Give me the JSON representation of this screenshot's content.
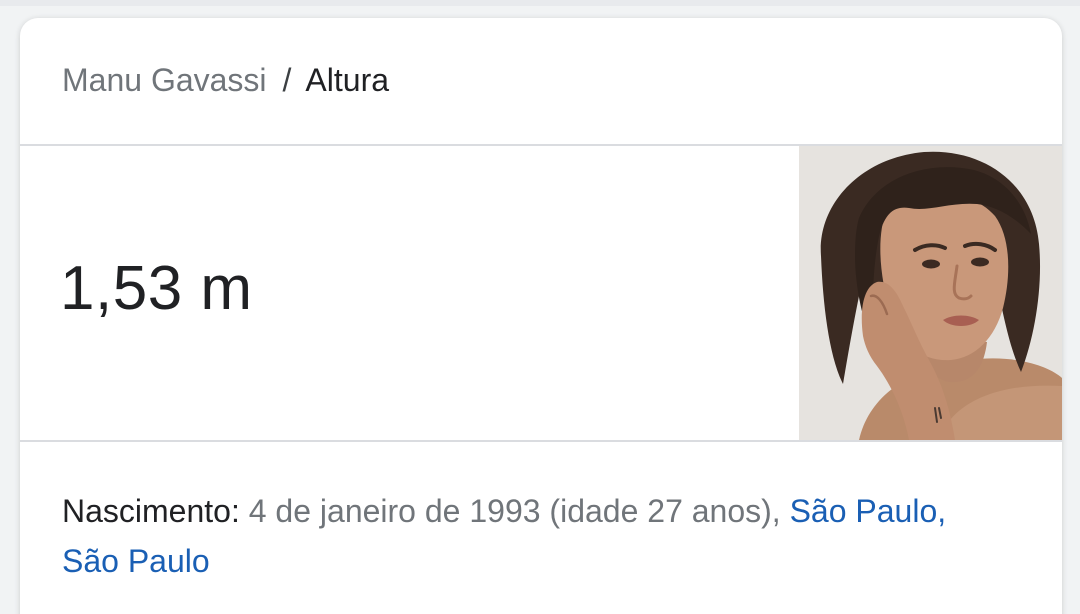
{
  "breadcrumb": {
    "entity": "Manu Gavassi",
    "separator": "/",
    "attribute": "Altura"
  },
  "answer": {
    "value": "1,53 m"
  },
  "photo": {
    "subject": "portrait-photo"
  },
  "facts": {
    "birth_label": "Nascimento:",
    "birth_value": " 4 de janeiro de 1993 (idade 27 anos), ",
    "birth_place_link": "São Paulo, São Paulo"
  },
  "colors": {
    "link": "#1a5fb4",
    "muted_text": "#70757a",
    "main_text": "#202124",
    "divider": "#dadce0"
  }
}
